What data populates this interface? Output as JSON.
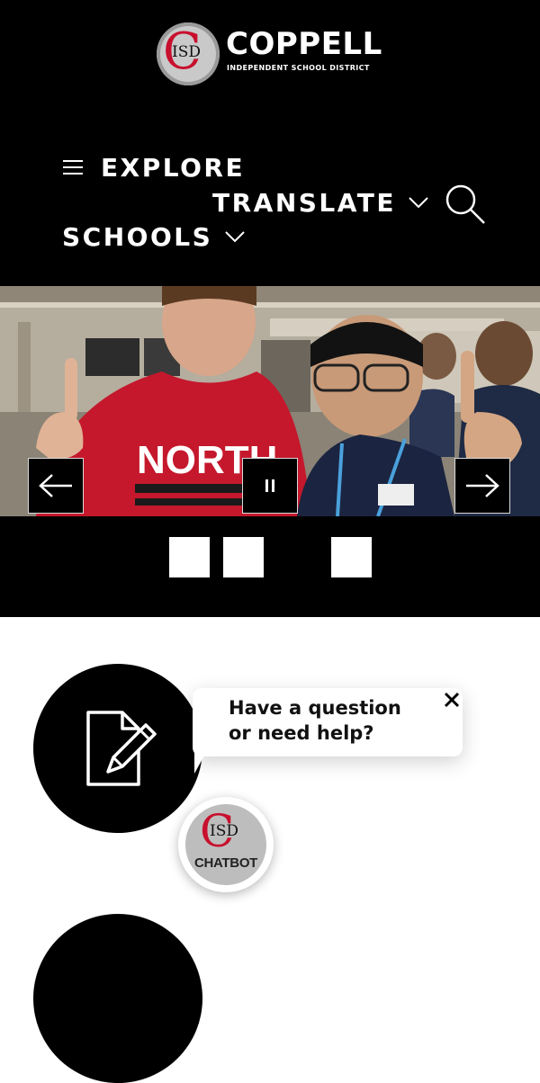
{
  "header": {
    "logo": {
      "seal_letter": "C",
      "seal_text": "ISD",
      "name": "COPPELL",
      "subtitle": "INDEPENDENT SCHOOL DISTRICT"
    },
    "nav": {
      "explore_label": "EXPLORE",
      "translate_label": "TRANSLATE",
      "schools_label": "SCHOOLS"
    }
  },
  "hero": {
    "slide_shirt_text": "NORTH",
    "dots_count": 3
  },
  "chat": {
    "prompt": "Have a question or need help?",
    "bot_seal_letter": "C",
    "bot_seal_text": "ISD",
    "bot_label": "CHATBOT"
  },
  "colors": {
    "background": "#000000",
    "accent_red": "#c8102e",
    "text_white": "#ffffff"
  }
}
